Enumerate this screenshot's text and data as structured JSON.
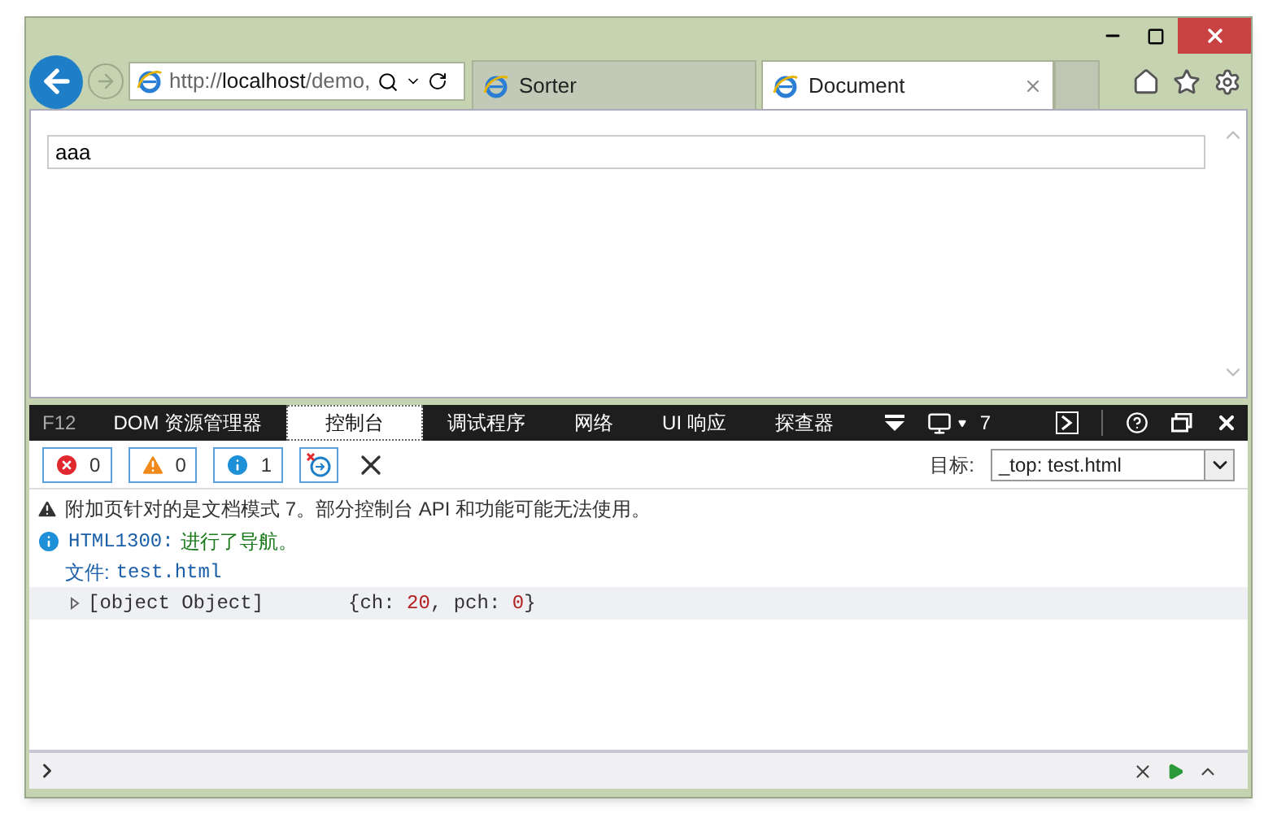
{
  "address": {
    "scheme": "http://",
    "host": "localhost",
    "path": "/demo,"
  },
  "tabs": [
    {
      "title": "Sorter",
      "selected": false
    },
    {
      "title": "Document",
      "selected": true
    }
  ],
  "page": {
    "input_value": "aaa"
  },
  "devtools": {
    "f12_label": "F12",
    "tabs": [
      {
        "label": "DOM 资源管理器",
        "selected": false
      },
      {
        "label": "控制台",
        "selected": true
      },
      {
        "label": "调试程序",
        "selected": false
      },
      {
        "label": "网络",
        "selected": false
      },
      {
        "label": "UI 响应",
        "selected": false
      },
      {
        "label": "探查器",
        "selected": false
      }
    ],
    "emulation_mode": "7",
    "counters": [
      {
        "kind": "error",
        "count": "0"
      },
      {
        "kind": "warning",
        "count": "0"
      },
      {
        "kind": "info",
        "count": "1"
      }
    ],
    "target_label": "目标:",
    "target_value": "_top: test.html",
    "messages": [
      {
        "kind": "warning",
        "text": "附加页针对的是文档模式 7。部分控制台 API 和功能可能无法使用。"
      },
      {
        "kind": "info",
        "code": "HTML1300:",
        "text": "进行了导航。"
      },
      {
        "kind": "file",
        "label": "文件:",
        "value": "test.html"
      },
      {
        "kind": "object",
        "expanded": false,
        "summary": "[object Object]",
        "preview": [
          {
            "kind": "punct",
            "text": "{ch: "
          },
          {
            "kind": "number",
            "text": "20"
          },
          {
            "kind": "punct",
            "text": ", pch: "
          },
          {
            "kind": "number",
            "text": "0"
          },
          {
            "kind": "punct",
            "text": "}"
          }
        ]
      }
    ]
  }
}
